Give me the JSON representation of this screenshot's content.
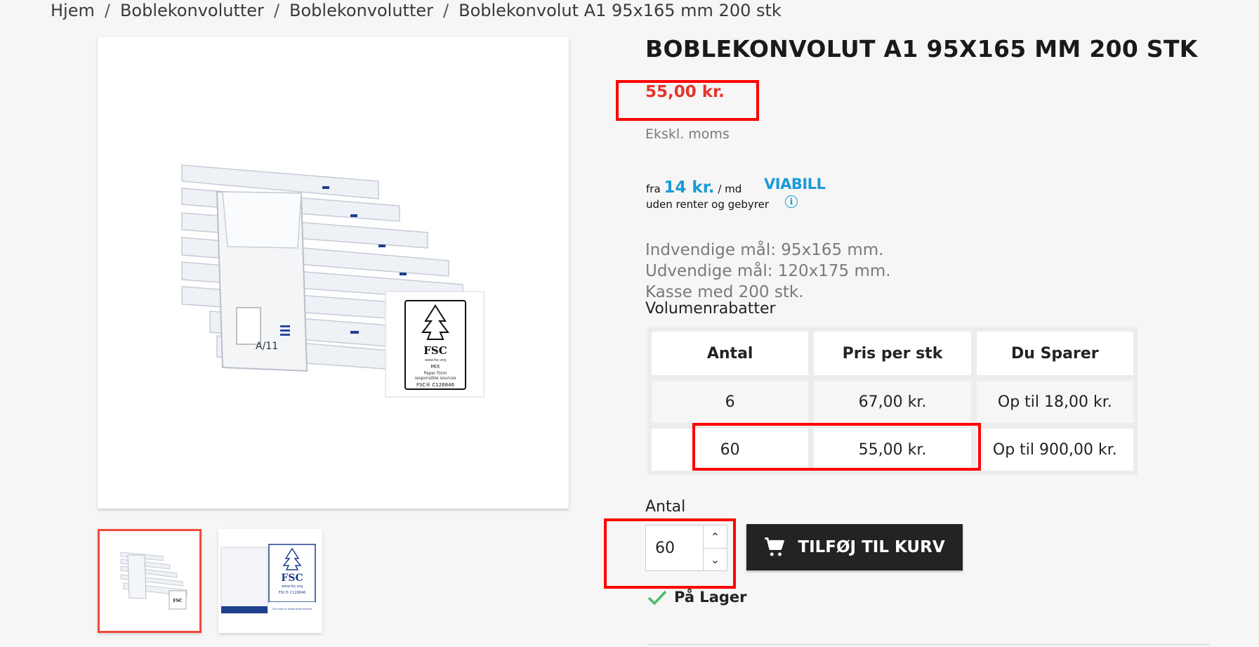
{
  "breadcrumb": {
    "items": [
      "Hjem",
      "Boblekonvolutter",
      "Boblekonvolutter",
      "Boblekonvolut A1 95x165 mm 200 stk"
    ],
    "separator": "/"
  },
  "product": {
    "title": "BOBLEKONVOLUT A1 95X165 MM 200 STK",
    "price": "55,00 kr.",
    "tax_note": "Ekskl. moms",
    "image_label": {
      "fsc": "FSC",
      "fsc_url": "www.fsc.org",
      "mix": "MIX",
      "paper_from": "Paper from",
      "sources_1": "responsible sources",
      "license": "FSC® C126846",
      "box_mark": "A/11"
    },
    "thumb2_label": {
      "fsc": "FSC",
      "fsc_url": "www.fsc.org",
      "license": "FSC® C126846",
      "tagline": "The mark of responsible forestry"
    }
  },
  "viabill": {
    "prefix": "fra",
    "amount": "14 kr.",
    "suffix": "/ md",
    "subtext": "uden renter og gebyrer",
    "logo": "VIABILL",
    "info_icon": "info-icon"
  },
  "description": [
    "Indvendige mål: 95x165 mm.",
    "Udvendige mål: 120x175 mm.",
    "Kasse med 200 stk."
  ],
  "volume": {
    "label": "Volumenrabatter",
    "headers": [
      "Antal",
      "Pris per stk",
      "Du Sparer"
    ],
    "rows": [
      [
        "6",
        "67,00 kr.",
        "Op til 18,00 kr."
      ],
      [
        "60",
        "55,00 kr.",
        "Op til 900,00 kr."
      ]
    ]
  },
  "purchase": {
    "qty_label": "Antal",
    "qty_value": "60",
    "add_to_cart": "TILFØJ TIL KURV",
    "cart_icon": "cart-icon",
    "stock": "På Lager",
    "stock_icon": "check-icon"
  },
  "colors": {
    "price": "#e4352a",
    "viabill": "#1a9bd7",
    "button_bg": "#232323",
    "highlight": "#ff0000",
    "thumb_selected": "#f04b3b"
  }
}
